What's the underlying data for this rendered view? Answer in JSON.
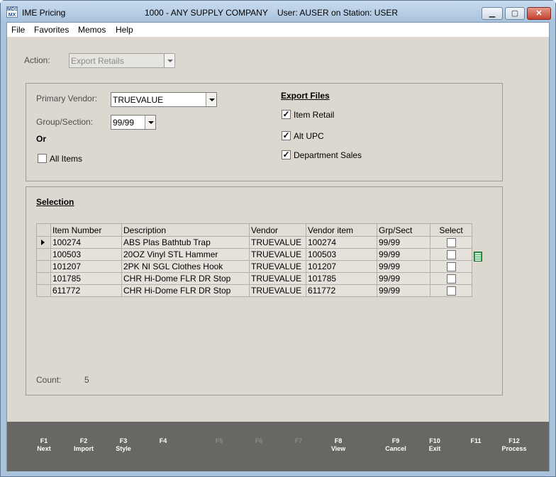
{
  "window": {
    "app_title": "IME Pricing",
    "company": "1000 - ANY SUPPLY COMPANY",
    "user_station": "User: AUSER on Station: USER",
    "icon_text_top": "MDS",
    "icon_text_bottom": "MX"
  },
  "menu": {
    "file": "File",
    "favorites": "Favorites",
    "memos": "Memos",
    "help": "Help"
  },
  "action": {
    "label": "Action:",
    "value": "Export Retails"
  },
  "criteria": {
    "primary_vendor_label": "Primary Vendor:",
    "primary_vendor_value": "TRUEVALUE",
    "group_section_label": "Group/Section:",
    "group_section_value": "99/99",
    "or_label": "Or",
    "all_items_label": "All Items",
    "all_items_checked": false
  },
  "export_files": {
    "heading": "Export Files",
    "item_retail_label": "Item Retail",
    "item_retail_checked": true,
    "alt_upc_label": "Alt UPC",
    "alt_upc_checked": true,
    "department_sales_label": "Department Sales",
    "department_sales_checked": true
  },
  "selection": {
    "heading": "Selection",
    "columns": [
      "Item Number",
      "Description",
      "Vendor",
      "Vendor item",
      "Grp/Sect",
      "Select"
    ],
    "rows": [
      {
        "item": "100274",
        "desc": "ABS Plas Bathtub Trap",
        "vendor": "TRUEVALUE",
        "vendor_item": "100274",
        "grp": "99/99",
        "selected": false
      },
      {
        "item": "100503",
        "desc": "20OZ Vinyl STL Hammer",
        "vendor": "TRUEVALUE",
        "vendor_item": "100503",
        "grp": "99/99",
        "selected": false
      },
      {
        "item": "101207",
        "desc": "2PK NI SGL Clothes Hook",
        "vendor": "TRUEVALUE",
        "vendor_item": "101207",
        "grp": "99/99",
        "selected": false
      },
      {
        "item": "101785",
        "desc": "CHR Hi-Dome FLR DR Stop",
        "vendor": "TRUEVALUE",
        "vendor_item": "101785",
        "grp": "99/99",
        "selected": false
      },
      {
        "item": "611772",
        "desc": "CHR Hi-Dome FLR DR Stop",
        "vendor": "TRUEVALUE",
        "vendor_item": "611772",
        "grp": "99/99",
        "selected": false
      }
    ],
    "count_label": "Count:",
    "count_value": "5"
  },
  "fkeys": [
    {
      "key": "F1",
      "label": "Next",
      "enabled": true
    },
    {
      "key": "F2",
      "label": "Import",
      "enabled": true
    },
    {
      "key": "F3",
      "label": "Style",
      "enabled": true
    },
    {
      "key": "F4",
      "label": "",
      "enabled": true
    },
    {
      "key": "F5",
      "label": "",
      "enabled": false
    },
    {
      "key": "F6",
      "label": "",
      "enabled": false
    },
    {
      "key": "F7",
      "label": "",
      "enabled": false
    },
    {
      "key": "F8",
      "label": "View",
      "enabled": true
    },
    {
      "key": "F9",
      "label": "Cancel",
      "enabled": true
    },
    {
      "key": "F10",
      "label": "Exit",
      "enabled": true
    },
    {
      "key": "F11",
      "label": "",
      "enabled": true
    },
    {
      "key": "F12",
      "label": "Process",
      "enabled": true
    }
  ],
  "window_buttons": {
    "minimize": "▁",
    "maximize": "▢",
    "close": "✕"
  }
}
